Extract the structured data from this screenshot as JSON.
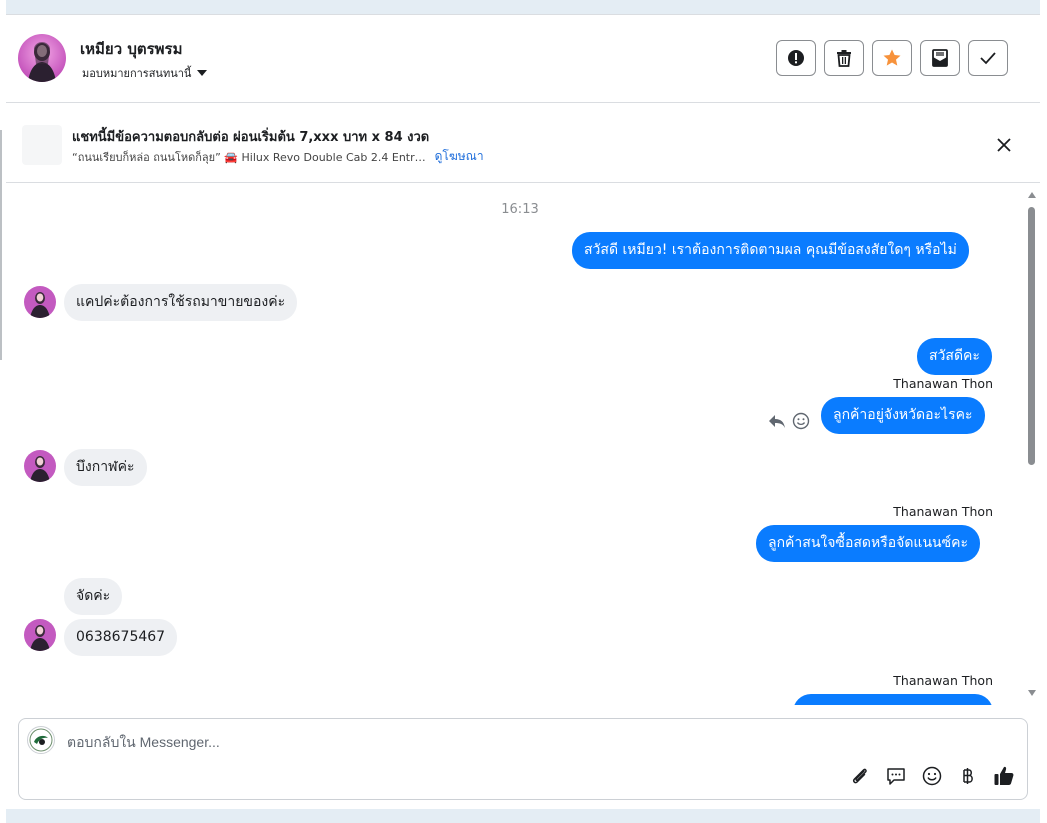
{
  "header": {
    "contact_name": "เหมียว บุตรพรม",
    "assign_label": "มอบหมายการสนทนานี้",
    "actions": [
      "spam-icon",
      "trash-icon",
      "star-icon",
      "mark-unread-icon",
      "done-icon"
    ],
    "star_color": "#f7923b"
  },
  "ad": {
    "title": "แชทนี้มีข้อความตอบกลับต่อ ผ่อนเริ่มต้น 7,xxx บาท x 84 งวด",
    "subtitle": "“ถนนเรียบก็หล่อ ถนนโหดก็ลุย” 🚘 Hilux Revo Double Cab 2.4 Entr…",
    "link": "ดูโฆษณา"
  },
  "messages": {
    "timestamp": "16:13",
    "m1": "สวัสดี เหมียว! เราต้องการติดตามผล คุณมีข้อสงสัยใดๆ หรือไม่",
    "m2": "แคปค่ะต้องการใช้รถมาขายของค่ะ",
    "m3": "สวัสดีคะ",
    "sender1": "Thanawan Thon",
    "m4": "ลูกค้าอยู่จังหวัดอะไรคะ",
    "m5": "บึงกาฬค่ะ",
    "sender2": "Thanawan Thon",
    "m6": "ลูกค้าสนใจซื้อสดหรือจัดแนนซ์คะ",
    "m7": "จัดค่ะ",
    "m8": "0638675467",
    "sender3": "Thanawan Thon"
  },
  "composer": {
    "placeholder": "ตอบกลับใน Messenger...",
    "tools": [
      "attach-icon",
      "saved-reply-icon",
      "emoji-icon",
      "baht-icon",
      "like-icon"
    ]
  },
  "colors": {
    "accent": "#0a7cff",
    "incoming_bubble": "#eef0f3",
    "link": "#216fdb"
  }
}
